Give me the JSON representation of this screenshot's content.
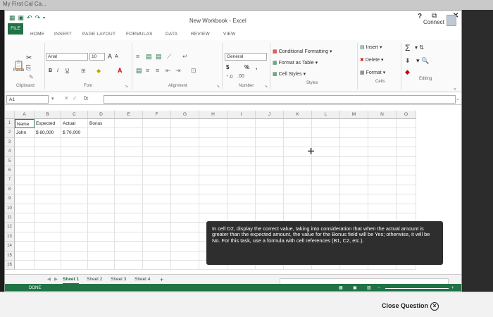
{
  "browser_tab": "My First Cal Ca...",
  "window": {
    "title": "New Workbook - Excel",
    "help": "?",
    "connect": "Connect"
  },
  "tabs": [
    "FILE",
    "HOME",
    "INSERT",
    "PAGE LAYOUT",
    "FORMULAS",
    "DATA",
    "REVIEW",
    "VIEW"
  ],
  "ribbon": {
    "clipboard": {
      "paste": "Paste",
      "label": "Clipboard"
    },
    "font": {
      "name": "Arial",
      "size": "10",
      "label": "Font",
      "grow": "A",
      "shrink": "A",
      "bold": "B",
      "italic": "I",
      "underline": "U"
    },
    "alignment": {
      "label": "Alignment"
    },
    "number": {
      "format": "General",
      "currency": "$",
      "percent": "%",
      "comma": ",",
      "label": "Number"
    },
    "styles": {
      "conditional": "Conditional Formatting",
      "table": "Format as Table",
      "cell": "Cell Styles",
      "label": "Styles"
    },
    "cells": {
      "insert": "Insert",
      "delete": "Delete",
      "format": "Format",
      "label": "Cells"
    },
    "editing": {
      "label": "Editing"
    }
  },
  "formula_bar": {
    "name_box": "A1",
    "fx": "fx",
    "value": ""
  },
  "columns": [
    "A",
    "B",
    "C",
    "D",
    "E",
    "F",
    "G",
    "H",
    "I",
    "J",
    "K",
    "L",
    "M",
    "N",
    "O"
  ],
  "rows": [
    "1",
    "2",
    "3",
    "4",
    "5",
    "6",
    "7",
    "8",
    "9",
    "10",
    "11",
    "12",
    "13",
    "14",
    "15",
    "16"
  ],
  "cells": {
    "A1": "Name",
    "B1": "Expected",
    "C1": "Actual",
    "D1": "Bonus",
    "A2": "John",
    "B2": "$ 60,000",
    "C2": "$ 70,000"
  },
  "sheets": [
    "Sheet 1",
    "Sheet 2",
    "Sheet 3",
    "Sheet 4"
  ],
  "add_sheet": "+",
  "status": "DONE",
  "instruction": "In cell D2, display the correct value, taking into consideration that when the actual amount is greater than the expected amount, the value for the Bonus field will be Yes; otherwise, it will be No. For this task, use a formula with cell references (B1, C2, etc.).",
  "close_question": "Close Question",
  "colors": {
    "excel_green": "#217346",
    "instruction_bg": "#2e2e2e"
  }
}
